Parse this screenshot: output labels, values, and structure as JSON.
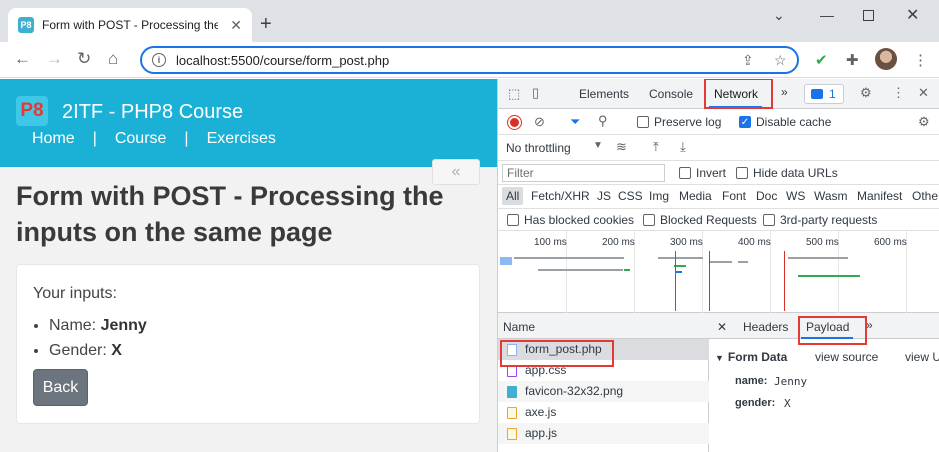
{
  "browser": {
    "tab_title": "Form with POST - Processing the",
    "favicon_text": "P8",
    "tab_close": "✕",
    "new_tab": "+",
    "url": "localhost:5500/course/form_post.php"
  },
  "site": {
    "logo_text": "P8",
    "title": "2ITF - PHP8 Course",
    "nav": [
      "Home",
      "Course",
      "Exercises"
    ],
    "nav_separator": "|",
    "collapse_label": "«"
  },
  "main": {
    "heading": "Form with POST - Processing the inputs on the same page",
    "card": {
      "label": "Your inputs:",
      "items": [
        {
          "key": "Name:",
          "value": "Jenny"
        },
        {
          "key": "Gender:",
          "value": "X"
        }
      ],
      "back_button": "Back"
    }
  },
  "devtools": {
    "tabs": [
      "Elements",
      "Console",
      "Network"
    ],
    "more": "»",
    "message_count": "1",
    "toolbar": {
      "preserve_log": "Preserve log",
      "disable_cache": "Disable cache",
      "throttling": "No throttling"
    },
    "filter": {
      "placeholder": "Filter",
      "invert": "Invert",
      "hide_data_urls": "Hide data URLs"
    },
    "types": [
      "All",
      "Fetch/XHR",
      "JS",
      "CSS",
      "Img",
      "Media",
      "Font",
      "Doc",
      "WS",
      "Wasm",
      "Manifest",
      "Othe"
    ],
    "blocked": {
      "cookies": "Has blocked cookies",
      "requests": "Blocked Requests",
      "third_party": "3rd-party requests"
    },
    "timeline_ticks": [
      "100 ms",
      "200 ms",
      "300 ms",
      "400 ms",
      "500 ms",
      "600 ms"
    ],
    "list": {
      "header": "Name",
      "requests": [
        "form_post.php",
        "app.css",
        "favicon-32x32.png",
        "axe.js",
        "app.js"
      ]
    },
    "detail": {
      "close": "✕",
      "tabs": [
        "Headers",
        "Payload"
      ],
      "more": "»",
      "section": "Form Data",
      "view_source": "view source",
      "view_url": "view U",
      "fields": [
        {
          "key": "name:",
          "value": "Jenny"
        },
        {
          "key": "gender:",
          "value": "X"
        }
      ]
    }
  },
  "colors": {
    "accent": "#1bb1d6",
    "highlight": "#e53935",
    "devtools_blue": "#1a73e8"
  }
}
